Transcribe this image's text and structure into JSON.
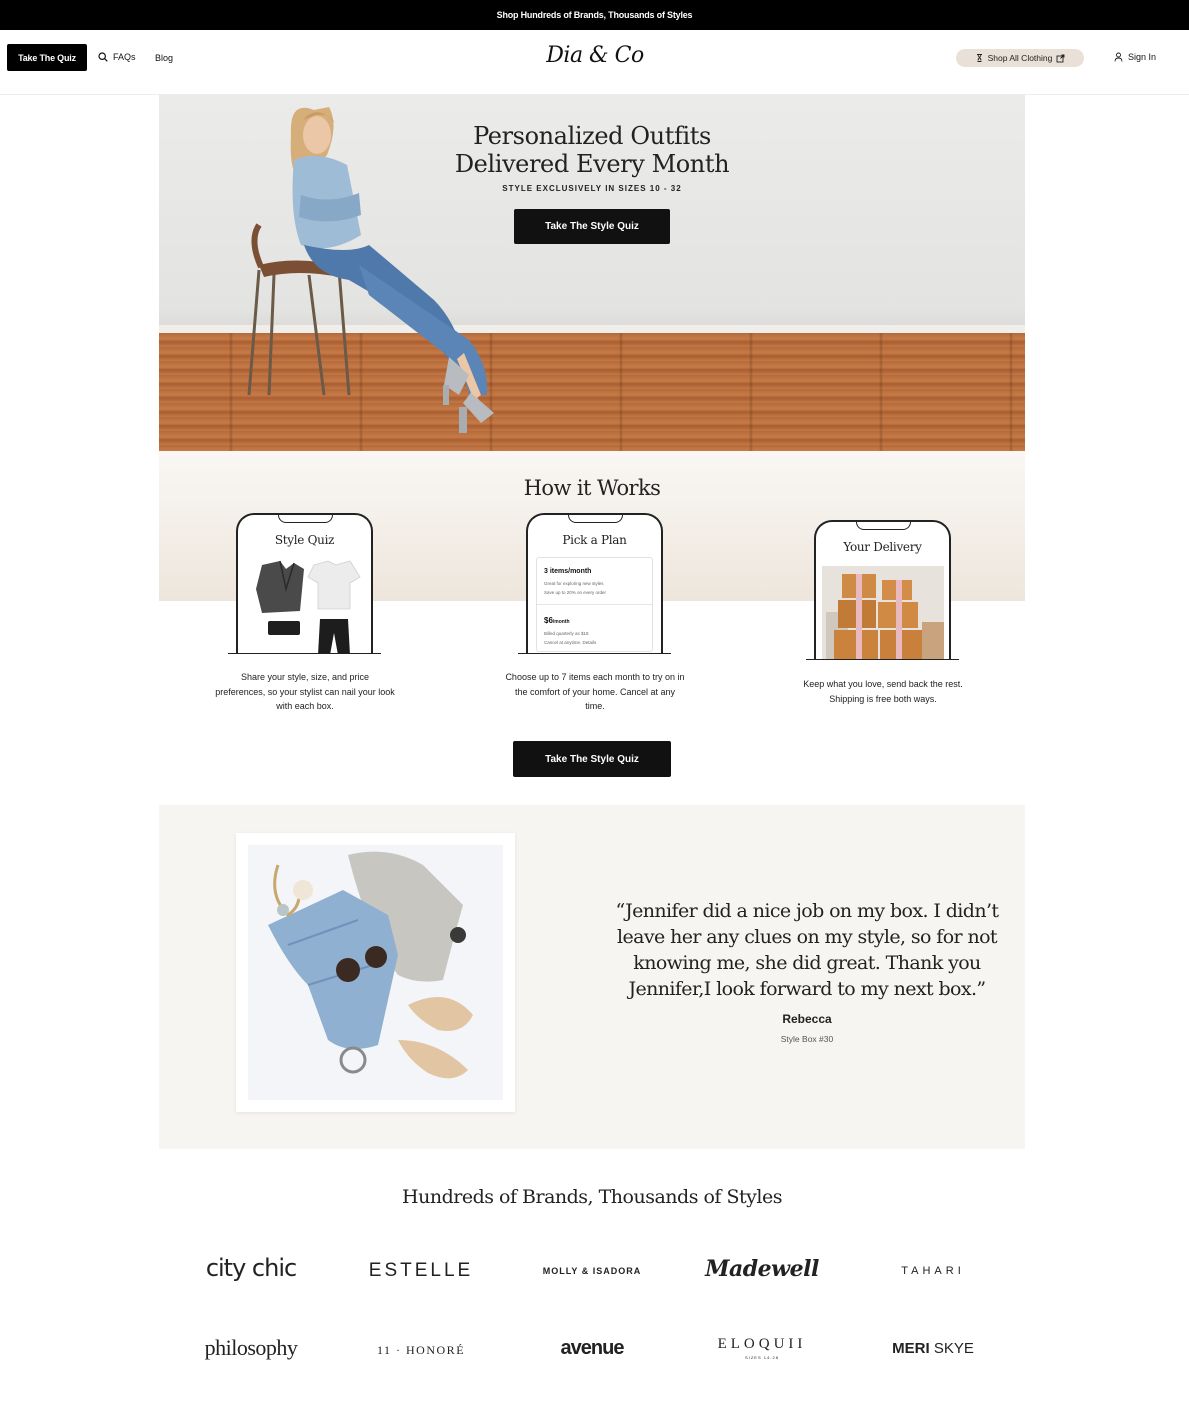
{
  "announcement": "Shop Hundreds of Brands, Thousands of Styles",
  "nav": {
    "quiz_button": "Take The Quiz",
    "faqs": "FAQs",
    "blog": "Blog",
    "logo": "Dia & Co",
    "shop_all": "Shop All Clothing",
    "sign_in": "Sign In"
  },
  "hero": {
    "title_line1": "Personalized Outfits",
    "title_line2": "Delivered Every Month",
    "subtitle": "STYLE EXCLUSIVELY IN SIZES 10 - 32",
    "cta": "Take The Style Quiz"
  },
  "how": {
    "title": "How it Works",
    "steps": [
      {
        "title": "Style Quiz",
        "text": "Share your style, size, and price preferences, so your stylist can nail your look with each box."
      },
      {
        "title": "Pick a Plan",
        "text": "Choose up to 7 items each month to try on in the comfort of your home. Cancel at any time.",
        "plan1_title": "3 items/month",
        "plan1_l1": "Great for exploring new styles",
        "plan1_l2": "Save up to 20% on every order",
        "plan2_price": "$6",
        "plan2_unit": "/month",
        "plan2_l1": "Billed quarterly as $18",
        "plan2_l2": "Cancel at anytime. Details"
      },
      {
        "title": "Your Delivery",
        "text": "Keep what you love, send back the rest. Shipping is free both ways."
      }
    ],
    "cta": "Take The Style Quiz"
  },
  "testimonial": {
    "quote": "“Jennifer did a nice job on my box. I didn’t leave her any clues on my style, so for not knowing me, she did great. Thank you Jennifer,I look forward to my next box.”",
    "author": "Rebecca",
    "box": "Style Box #30"
  },
  "brands": {
    "title": "Hundreds of Brands, Thousands of Styles",
    "row1": [
      "city chic",
      "ESTELLE",
      "MOLLY & ISADORA",
      "Madewell",
      "TAHARI"
    ],
    "row2": [
      "philosophy",
      "11 · HONORÉ",
      "avenue",
      "ELOQUII",
      "MERI SKYE"
    ],
    "eloquii_sub": "SIZES 14-28",
    "meri_1": "MERI",
    "meri_2": "SKYE"
  }
}
